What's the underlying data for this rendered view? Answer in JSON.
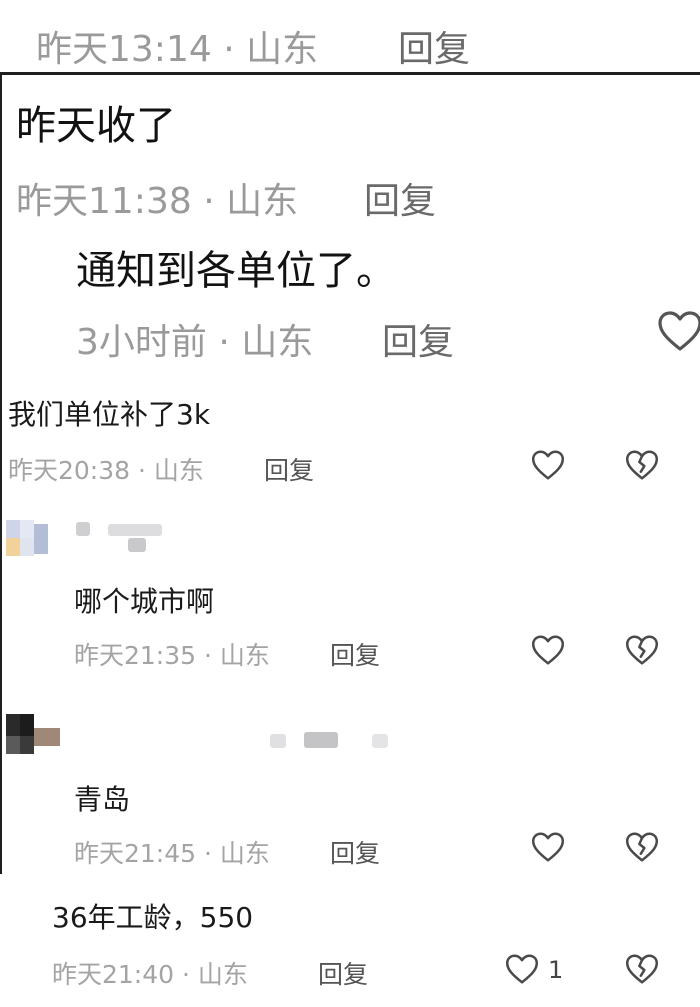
{
  "thread": {
    "top_meta": {
      "time": "昨天13:14 · 山东",
      "reply": "回复"
    },
    "comment_a": {
      "text": "昨天收了",
      "time": "昨天11:38 · 山东",
      "reply": "回复"
    },
    "comment_b": {
      "text": "通知到各单位了。",
      "time": "3小时前 · 山东",
      "reply": "回复"
    }
  },
  "comments": [
    {
      "text": "我们单位补了3k",
      "time": "昨天20:38 · 山东",
      "reply": "回复"
    },
    {
      "text": "哪个城市啊",
      "time": "昨天21:35 · 山东",
      "reply": "回复"
    },
    {
      "text": "青岛",
      "time": "昨天21:45 · 山东",
      "reply": "回复"
    },
    {
      "text": "36年工龄，550",
      "time": "昨天21:40 · 山东",
      "reply": "回复",
      "like_count": "1"
    }
  ],
  "icons": {
    "like": "heart-outline-icon",
    "dislike": "broken-heart-icon"
  },
  "colors": {
    "meta": "#a4a4a4",
    "text": "#1a1a1a",
    "icon": "#4a4a4a"
  }
}
